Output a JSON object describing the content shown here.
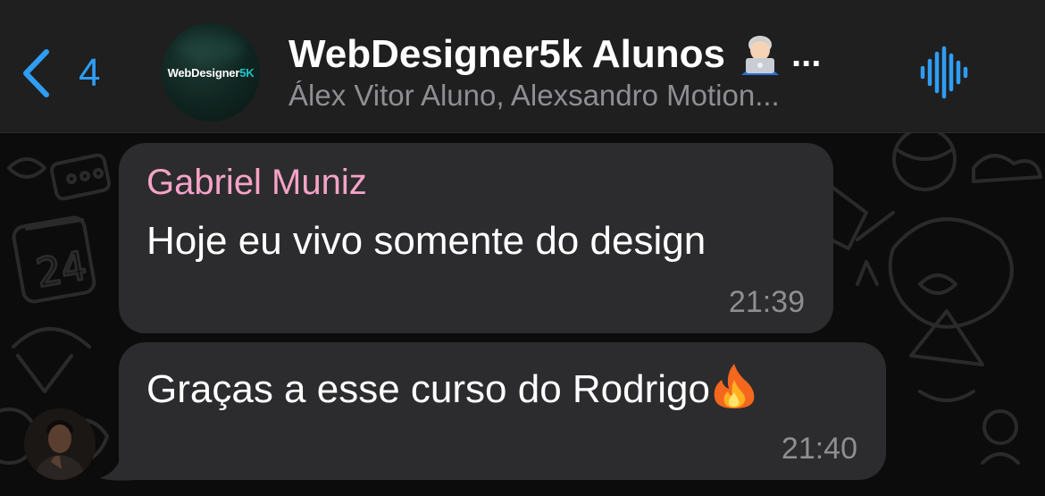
{
  "header": {
    "back_count": "4",
    "group_title": "WebDesigner5k Alunos",
    "title_emoji": "technologist-emoji",
    "title_ellipsis": "...",
    "members": "Álex Vitor Aluno, Alexsandro Motion...",
    "avatar_logo_main": "WebDesigner",
    "avatar_logo_accent": "5K",
    "voice_icon": "voice-chat-icon",
    "back_icon": "chevron-left-icon"
  },
  "messages": [
    {
      "sender": "Gabriel Muniz",
      "text": "Hoje eu vivo somente do design",
      "time": "21:39"
    },
    {
      "text": "Graças a esse curso do Rodrigo",
      "emoji": "fire-emoji",
      "time": "21:40"
    }
  ],
  "colors": {
    "accent": "#2f9df4",
    "sender_name": "#f6a3c7",
    "bubble": "#2c2c2e",
    "header_bg": "#1f1f1f",
    "muted_text": "#8e8e93",
    "logo_accent": "#25c3c9"
  }
}
